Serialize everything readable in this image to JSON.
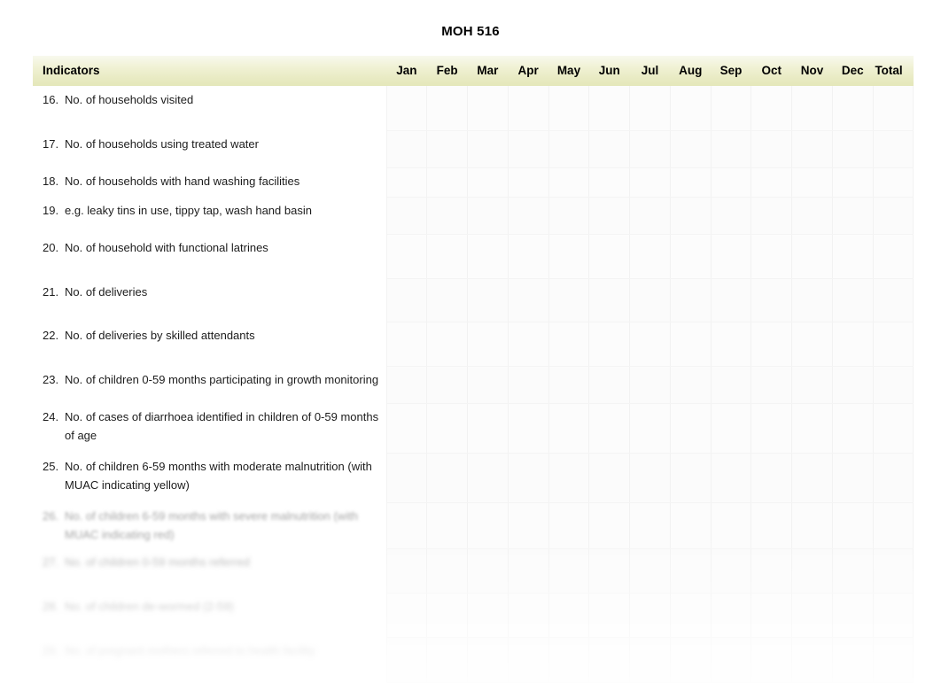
{
  "document": {
    "title": "MOH 516"
  },
  "table": {
    "columns": [
      {
        "key": "indicators",
        "label": "Indicators"
      },
      {
        "key": "jan",
        "label": "Jan"
      },
      {
        "key": "feb",
        "label": "Feb"
      },
      {
        "key": "mar",
        "label": "Mar"
      },
      {
        "key": "apr",
        "label": "Apr"
      },
      {
        "key": "may",
        "label": "May"
      },
      {
        "key": "jun",
        "label": "Jun"
      },
      {
        "key": "jul",
        "label": "Jul"
      },
      {
        "key": "aug",
        "label": "Aug"
      },
      {
        "key": "sep",
        "label": "Sep"
      },
      {
        "key": "oct",
        "label": "Oct"
      },
      {
        "key": "nov",
        "label": "Nov"
      },
      {
        "key": "dec",
        "label": "Dec"
      },
      {
        "key": "total",
        "label": "Total"
      }
    ],
    "header_colors": {
      "header_background_top": "#f8f9ee",
      "header_background_bottom": "#e4e7b9",
      "cell_border": "#f2f2f2",
      "text": "#1a1a1a"
    },
    "rows": [
      {
        "number": "16.",
        "text": "No. of households visited",
        "values": [
          "",
          "",
          "",
          "",
          "",
          "",
          "",
          "",
          "",
          "",
          "",
          "",
          ""
        ]
      },
      {
        "number": "17.",
        "text": "No. of households using treated water",
        "values": [
          "",
          "",
          "",
          "",
          "",
          "",
          "",
          "",
          "",
          "",
          "",
          "",
          ""
        ]
      },
      {
        "number": "18.",
        "text": "No. of households with hand washing facilities",
        "values": [
          "",
          "",
          "",
          "",
          "",
          "",
          "",
          "",
          "",
          "",
          "",
          "",
          ""
        ]
      },
      {
        "number": "19.",
        "text": "e.g. leaky tins in use, tippy tap, wash hand basin",
        "values": [
          "",
          "",
          "",
          "",
          "",
          "",
          "",
          "",
          "",
          "",
          "",
          "",
          ""
        ]
      },
      {
        "number": "20.",
        "text": "No. of household with functional latrines",
        "values": [
          "",
          "",
          "",
          "",
          "",
          "",
          "",
          "",
          "",
          "",
          "",
          "",
          ""
        ]
      },
      {
        "number": "21.",
        "text": "No. of deliveries",
        "values": [
          "",
          "",
          "",
          "",
          "",
          "",
          "",
          "",
          "",
          "",
          "",
          "",
          ""
        ]
      },
      {
        "number": "22.",
        "text": "No. of deliveries by skilled attendants",
        "values": [
          "",
          "",
          "",
          "",
          "",
          "",
          "",
          "",
          "",
          "",
          "",
          "",
          ""
        ]
      },
      {
        "number": "23.",
        "text": "No. of children 0-59 months participating in growth monitoring",
        "values": [
          "",
          "",
          "",
          "",
          "",
          "",
          "",
          "",
          "",
          "",
          "",
          "",
          ""
        ]
      },
      {
        "number": "24.",
        "text": "No. of cases of diarrhoea identified in children of 0-59 months of age",
        "values": [
          "",
          "",
          "",
          "",
          "",
          "",
          "",
          "",
          "",
          "",
          "",
          "",
          ""
        ]
      },
      {
        "number": "25.",
        "text": "No. of children 6-59 months with moderate malnutrition (with MUAC indicating yellow)",
        "values": [
          "",
          "",
          "",
          "",
          "",
          "",
          "",
          "",
          "",
          "",
          "",
          "",
          ""
        ]
      },
      {
        "number": "26.",
        "text": "No. of children 6-59 months with severe malnutrition (with MUAC indicating red)",
        "values": [
          "",
          "",
          "",
          "",
          "",
          "",
          "",
          "",
          "",
          "",
          "",
          "",
          ""
        ]
      },
      {
        "number": "27.",
        "text": "No. of children 0-59 months referred",
        "values": [
          "",
          "",
          "",
          "",
          "",
          "",
          "",
          "",
          "",
          "",
          "",
          "",
          ""
        ]
      },
      {
        "number": "28.",
        "text": "No. of children de-wormed (2-59)",
        "values": [
          "",
          "",
          "",
          "",
          "",
          "",
          "",
          "",
          "",
          "",
          "",
          "",
          ""
        ]
      },
      {
        "number": "29.",
        "text": "No. of pregnant mothers referred to health facility",
        "values": [
          "",
          "",
          "",
          "",
          "",
          "",
          "",
          "",
          "",
          "",
          "",
          "",
          ""
        ]
      }
    ]
  }
}
